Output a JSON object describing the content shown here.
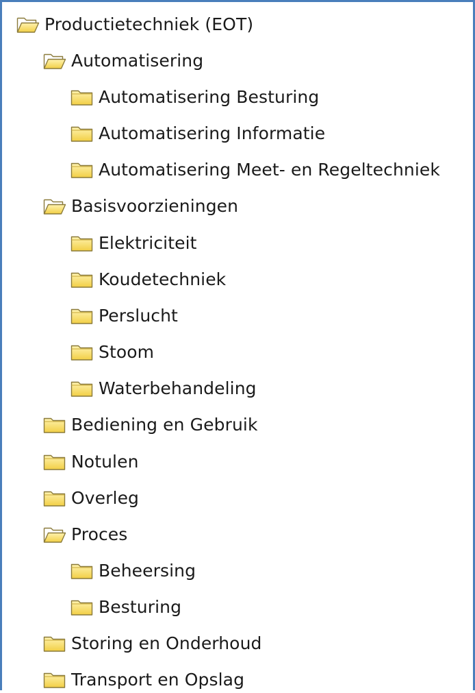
{
  "tree": {
    "root": {
      "label": "Productietechniek (EOT)",
      "icon": "folder-open-icon"
    },
    "automatisering": {
      "label": "Automatisering",
      "icon": "folder-open-icon"
    },
    "automatisering_besturing": {
      "label": "Automatisering Besturing",
      "icon": "folder-icon"
    },
    "automatisering_informatie": {
      "label": "Automatisering Informatie",
      "icon": "folder-icon"
    },
    "automatisering_meet": {
      "label": "Automatisering Meet- en Regeltechniek",
      "icon": "folder-icon"
    },
    "basisvoorzieningen": {
      "label": "Basisvoorzieningen",
      "icon": "folder-open-icon"
    },
    "elektriciteit": {
      "label": "Elektriciteit",
      "icon": "folder-icon"
    },
    "koudetechniek": {
      "label": "Koudetechniek",
      "icon": "folder-icon"
    },
    "perslucht": {
      "label": "Perslucht",
      "icon": "folder-icon"
    },
    "stoom": {
      "label": "Stoom",
      "icon": "folder-icon"
    },
    "waterbehandeling": {
      "label": "Waterbehandeling",
      "icon": "folder-icon"
    },
    "bediening": {
      "label": "Bediening en Gebruik",
      "icon": "folder-icon"
    },
    "notulen": {
      "label": "Notulen",
      "icon": "folder-icon"
    },
    "overleg": {
      "label": "Overleg",
      "icon": "folder-icon"
    },
    "proces": {
      "label": "Proces",
      "icon": "folder-open-icon"
    },
    "beheersing": {
      "label": "Beheersing",
      "icon": "folder-icon"
    },
    "besturing": {
      "label": "Besturing",
      "icon": "folder-icon"
    },
    "storing": {
      "label": "Storing en Onderhoud",
      "icon": "folder-icon"
    },
    "transport": {
      "label": "Transport en Opslag",
      "icon": "folder-icon"
    }
  },
  "colors": {
    "frame_border": "#4a7ebb",
    "folder_fill": "#f7dd6a",
    "folder_stroke": "#8a7a3a",
    "text": "#1a1a1a"
  }
}
